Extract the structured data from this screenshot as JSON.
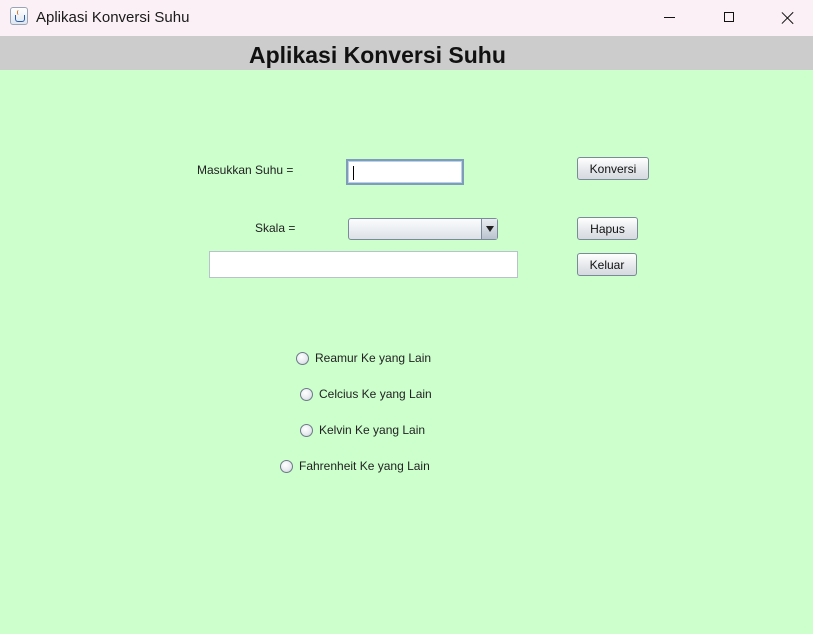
{
  "window": {
    "title": "Aplikasi Konversi Suhu",
    "icon": "java-cup-icon"
  },
  "header": {
    "title": "Aplikasi Konversi Suhu"
  },
  "form": {
    "input_label": "Masukkan Suhu =",
    "input_value": "",
    "scale_label": "Skala =",
    "scale_selected": "",
    "result_value": ""
  },
  "buttons": {
    "convert": "Konversi",
    "clear": "Hapus",
    "exit": "Keluar"
  },
  "radios": [
    {
      "label": "Reamur Ke yang Lain",
      "checked": false
    },
    {
      "label": "Celcius Ke yang Lain",
      "checked": false
    },
    {
      "label": "Kelvin Ke yang Lain",
      "checked": false
    },
    {
      "label": "Fahrenheit Ke yang Lain",
      "checked": false
    }
  ],
  "colors": {
    "panel_background": "#ccffcc",
    "header_background": "#cccccc",
    "titlebar_background": "#fbf0f6"
  }
}
